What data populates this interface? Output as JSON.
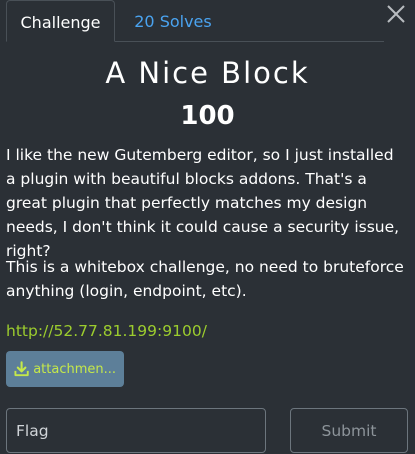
{
  "tabs": {
    "challenge_label": "Challenge",
    "solves_label": "20 Solves"
  },
  "challenge": {
    "name": "A Nice Block",
    "value": "100",
    "description_p1": "I like the new Gutemberg editor, so I just installed a plugin with beautiful blocks addons. That's a great plugin that perfectly matches my design needs, I don't think it could cause a security issue, right?",
    "description_p2": "This is a whitebox challenge, no need to bruteforce anything (login, endpoint, etc).",
    "link": "http://52.77.81.199:9100/",
    "attachment_label": "attachmen..."
  },
  "form": {
    "flag_placeholder": "Flag",
    "submit_label": "Submit"
  },
  "icons": {
    "close": "close-icon",
    "download": "download-icon"
  },
  "colors": {
    "background": "#2b3036",
    "link": "#9ccc2e",
    "tab_link": "#4aa3f0",
    "attachment_bg": "#5d7f99"
  }
}
